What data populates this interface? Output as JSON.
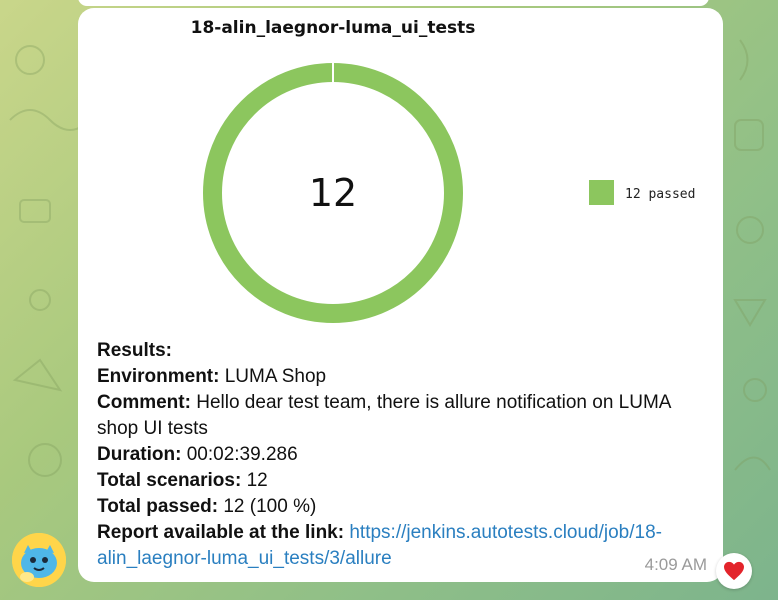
{
  "message": {
    "chart_title": "18-alin_laegnor-luma_ui_tests",
    "results_label": "Results:",
    "fields": [
      {
        "label": "Environment:",
        "value": "LUMA Shop"
      },
      {
        "label": "Comment:",
        "value": "Hello dear test team, there is allure notification on LUMA shop UI tests"
      },
      {
        "label": "Duration:",
        "value": "00:02:39.286"
      },
      {
        "label": "Total scenarios:",
        "value": "12"
      },
      {
        "label": "Total passed:",
        "value": "12 (100 %)"
      }
    ],
    "report_label": "Report available at the link:",
    "report_link": "https://jenkins.autotests.cloud/job/18-alin_laegnor-luma_ui_tests/3/allure",
    "time": "4:09 AM",
    "reaction_icon": "heart-icon"
  },
  "chart_data": {
    "type": "pie",
    "title": "18-alin_laegnor-luma_ui_tests",
    "center_label": "12",
    "series": [
      {
        "name": "12 passed",
        "value": 12,
        "color": "#8cc65e"
      }
    ],
    "legend_position": "right"
  },
  "colors": {
    "passed": "#8cc65e",
    "link": "#2a7fc0",
    "reaction": "#e3242b"
  }
}
